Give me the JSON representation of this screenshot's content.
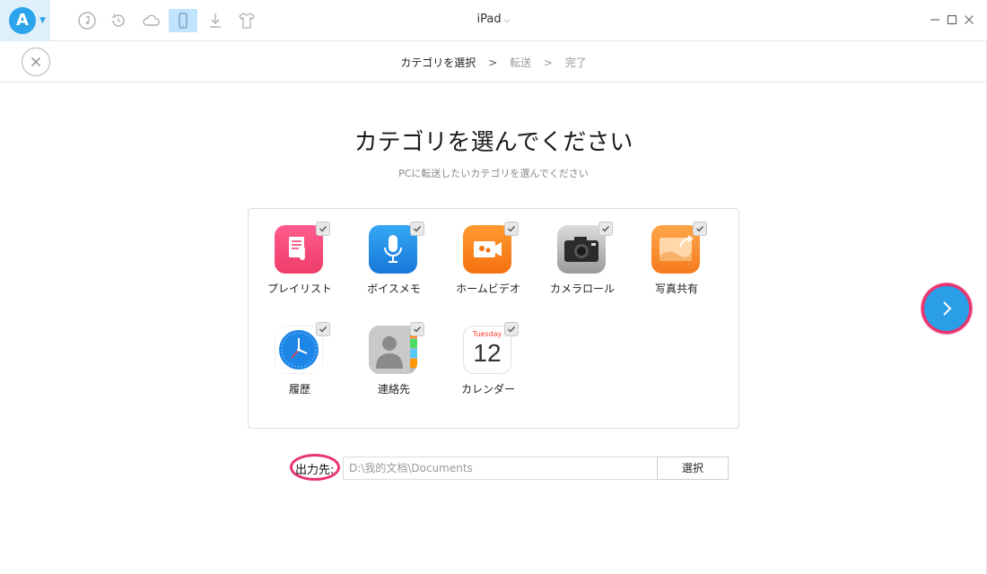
{
  "app": {
    "logo_letter": "A",
    "device": "iPad",
    "device_chevron": "⌵"
  },
  "toolbar": {
    "icons": [
      "music-icon",
      "restore-icon",
      "cloud-icon",
      "device-icon",
      "download-icon",
      "shirt-icon"
    ],
    "active": "device-icon"
  },
  "steps": {
    "current": "カテゴリを選択",
    "sep1": ">",
    "second": "転送",
    "sep2": ">",
    "third": "完了"
  },
  "page": {
    "title": "カテゴリを選んでください",
    "subtitle": "PCに転送したいカテゴリを選んでください"
  },
  "categories": [
    {
      "label": "プレイリスト",
      "icon": "playlist-icon",
      "checked": true
    },
    {
      "label": "ボイスメモ",
      "icon": "voice-memo-icon",
      "checked": true
    },
    {
      "label": "ホームビデオ",
      "icon": "home-video-icon",
      "checked": true
    },
    {
      "label": "カメラロール",
      "icon": "camera-roll-icon",
      "checked": true
    },
    {
      "label": "写真共有",
      "icon": "photo-share-icon",
      "checked": true
    },
    {
      "label": "履歴",
      "icon": "history-icon",
      "checked": true
    },
    {
      "label": "連絡先",
      "icon": "contacts-icon",
      "checked": true
    },
    {
      "label": "カレンダー",
      "icon": "calendar-icon",
      "checked": true
    }
  ],
  "calendar_icon": {
    "day_name": "Tuesday",
    "day_number": "12"
  },
  "output": {
    "label": "出力先:",
    "path": "D:\\我的文档\\Documents",
    "button": "選択"
  },
  "colors": {
    "accent": "#2b9ee8",
    "highlight": "#e8336f"
  }
}
